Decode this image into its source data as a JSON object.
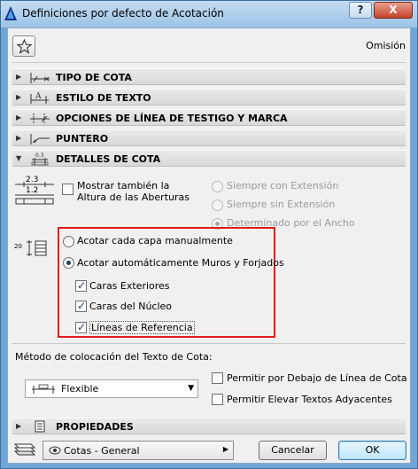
{
  "window": {
    "title": "Definiciones por defecto de Acotación",
    "help_label": "?",
    "close_label": "X"
  },
  "header": {
    "favorites_icon": "star-icon",
    "preset": "Omisión"
  },
  "panels": [
    {
      "label": "TIPO DE COTA",
      "icon": "dimension-type-icon"
    },
    {
      "label": "ESTILO DE TEXTO",
      "icon": "text-style-icon"
    },
    {
      "label": "OPCIONES DE LÍNEA DE TESTIGO Y MARCA",
      "icon": "witness-line-icon"
    },
    {
      "label": "PUNTERO",
      "icon": "pointer-icon"
    },
    {
      "label": "DETALLES DE COTA",
      "icon": "dimension-details-icon"
    }
  ],
  "details": {
    "opening_icon_text": {
      "top": "2.3",
      "bottom": "1.2"
    },
    "show_height_label": "Mostrar también la Altura de las Aberturas",
    "show_height_checked": false,
    "extension_options": [
      {
        "label": "Siempre con Extensión",
        "checked": false
      },
      {
        "label": "Siempre sin Extensión",
        "checked": false
      },
      {
        "label": "Determinado por el Ancho",
        "checked": true
      }
    ],
    "layers_icon_text": "20",
    "layer_options": [
      {
        "label": "Acotar cada capa manualmente",
        "checked": false
      },
      {
        "label": "Acotar automáticamente Muros y Forjados",
        "checked": true
      }
    ],
    "auto_checks": [
      {
        "label": "Caras Exteriores",
        "checked": true
      },
      {
        "label": "Caras del Núcleo",
        "checked": true
      },
      {
        "label": "Líneas de Referencia",
        "checked": true
      }
    ],
    "placement_label": "Método de colocación del Texto de Cota:",
    "placement_value": "Flexible",
    "placement_checks": [
      {
        "label": "Permitir por Debajo de Línea de Cota",
        "checked": false
      },
      {
        "label": "Permitir Elevar Textos Adyacentes",
        "checked": false
      }
    ]
  },
  "properties_panel": {
    "label": "PROPIEDADES",
    "icon": "properties-icon"
  },
  "footer": {
    "layer_combo": "Cotas - General",
    "cancel_label": "Cancelar",
    "ok_label": "OK"
  },
  "colors": {
    "highlight": "#e41a1a",
    "accent": "#1c3f82"
  }
}
